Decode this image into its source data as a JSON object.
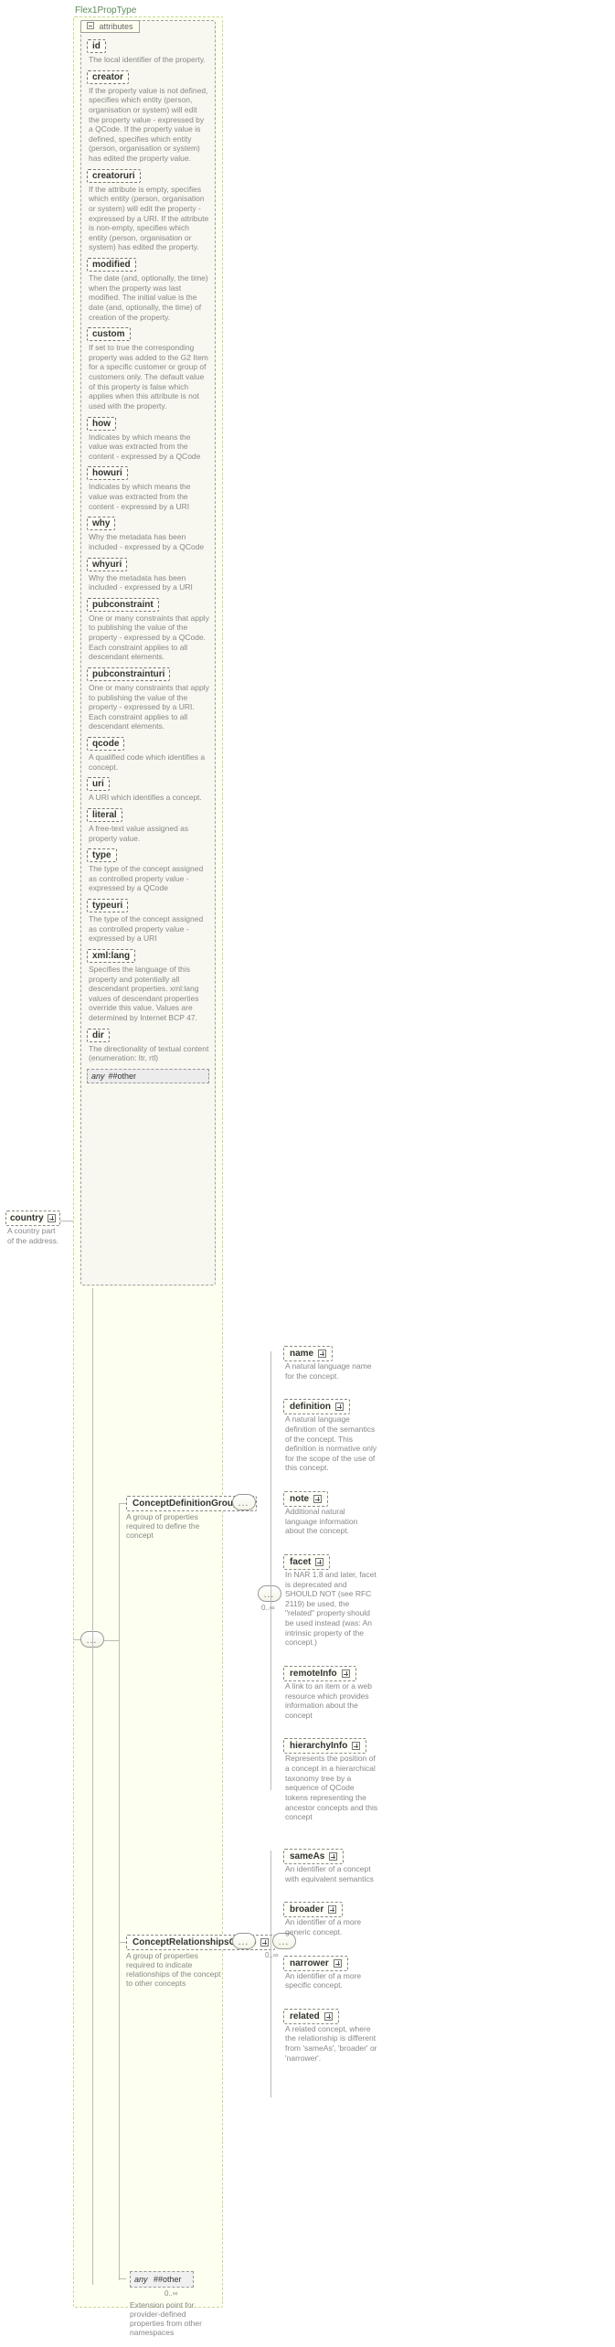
{
  "root_type": "Flex1PropType",
  "attributes_label": "attributes",
  "attributes": [
    {
      "id": "id",
      "name": "id",
      "desc": "The local identifier of the property."
    },
    {
      "id": "creator",
      "name": "creator",
      "desc": "If the property value is not defined, specifies which entity (person, organisation or system) will edit the property value - expressed by a QCode. If the property value is defined, specifies which entity (person, organisation or system) has edited the property value."
    },
    {
      "id": "creatoruri",
      "name": "creatoruri",
      "desc": "If the attribute is empty, specifies which entity (person, organisation or system) will edit the property - expressed by a URI. If the attribute is non-empty, specifies which entity (person, organisation or system) has edited the property."
    },
    {
      "id": "modified",
      "name": "modified",
      "desc": "The date (and, optionally, the time) when the property was last modified. The initial value is the date (and, optionally, the time) of creation of the property."
    },
    {
      "id": "custom",
      "name": "custom",
      "desc": "If set to true the corresponding property was added to the G2 Item for a specific customer or group of customers only. The default value of this property is false which applies when this attribute is not used with the property."
    },
    {
      "id": "how",
      "name": "how",
      "desc": "Indicates by which means the value was extracted from the content - expressed by a QCode"
    },
    {
      "id": "howuri",
      "name": "howuri",
      "desc": "Indicates by which means the value was extracted from the content - expressed by a URI"
    },
    {
      "id": "why",
      "name": "why",
      "desc": "Why the metadata has been included - expressed by a QCode"
    },
    {
      "id": "whyuri",
      "name": "whyuri",
      "desc": "Why the metadata has been included - expressed by a URI"
    },
    {
      "id": "pubconstraint",
      "name": "pubconstraint",
      "desc": "One or many constraints that apply to publishing the value of the property - expressed by a QCode. Each constraint applies to all descendant elements."
    },
    {
      "id": "pubconstrainturi",
      "name": "pubconstrainturi",
      "desc": "One or many constraints that apply to publishing the value of the property - expressed by a URI. Each constraint applies to all descendant elements."
    },
    {
      "id": "qcode",
      "name": "qcode",
      "desc": "A qualified code which identifies a concept."
    },
    {
      "id": "uri",
      "name": "uri",
      "desc": "A URI which identifies a concept."
    },
    {
      "id": "literal",
      "name": "literal",
      "desc": "A free-text value assigned as property value."
    },
    {
      "id": "type",
      "name": "type",
      "desc": "The type of the concept assigned as controlled property value - expressed by a QCode"
    },
    {
      "id": "typeuri",
      "name": "typeuri",
      "desc": "The type of the concept assigned as controlled property value - expressed by a URI"
    },
    {
      "id": "xmllang",
      "name": "xml:lang",
      "desc": "Specifies the language of this property and potentially all descendant properties. xml:lang values of descendant properties override this value. Values are determined by Internet BCP 47."
    },
    {
      "id": "dir",
      "name": "dir",
      "desc": "The directionality of textual content (enumeration: ltr, rtl)"
    }
  ],
  "attr_any": {
    "any": "any",
    "other": "##other"
  },
  "country": {
    "name": "country",
    "desc": "A country part of the address."
  },
  "groups": {
    "cdg": {
      "name": "ConceptDefinitionGroup",
      "desc": "A group of properties required to define the concept",
      "occurs": "0..∞"
    },
    "crg": {
      "name": "ConceptRelationshipsGroup",
      "desc": "A group of properties required to indicate relationships of the concept to other concepts",
      "occurs": "0..∞"
    }
  },
  "def_items": [
    {
      "id": "name",
      "name": "name",
      "desc": "A natural language name for the concept.",
      "dashed": true
    },
    {
      "id": "definition",
      "name": "definition",
      "desc": "A natural language definition of the semantics of the concept. This definition is normative only for the scope of the use of this concept.",
      "dashed": true
    },
    {
      "id": "note",
      "name": "note",
      "desc": "Additional natural language information about the concept.",
      "dashed": true
    },
    {
      "id": "facet",
      "name": "facet",
      "desc": "In NAR 1.8 and later, facet is deprecated and SHOULD NOT (see RFC 2119) be used, the \"related\" property should be used instead (was: An intrinsic property of the concept.)",
      "dashed": true
    },
    {
      "id": "remoteInfo",
      "name": "remoteInfo",
      "desc": "A link to an item or a web resource which provides information about the concept",
      "dashed": true
    },
    {
      "id": "hierarchyInfo",
      "name": "hierarchyInfo",
      "desc": "Represents the position of a concept in a hierarchical taxonomy tree by a sequence of QCode tokens representing the ancestor concepts and this concept",
      "dashed": true
    }
  ],
  "rel_items": [
    {
      "id": "sameAs",
      "name": "sameAs",
      "desc": "An identifier of a concept with equivalent semantics",
      "dashed": true
    },
    {
      "id": "broader",
      "name": "broader",
      "desc": "An identifier of a more generic concept.",
      "dashed": true
    },
    {
      "id": "narrower",
      "name": "narrower",
      "desc": "An identifier of a more specific concept.",
      "dashed": true
    },
    {
      "id": "related",
      "name": "related",
      "desc": "A related concept, where the relationship is different from 'sameAs', 'broader' or 'narrower'.",
      "dashed": true
    }
  ],
  "any_bottom": {
    "any": "any",
    "other": "##other",
    "occurs": "0..∞",
    "desc": "Extension point for provider-defined properties from other namespaces"
  }
}
